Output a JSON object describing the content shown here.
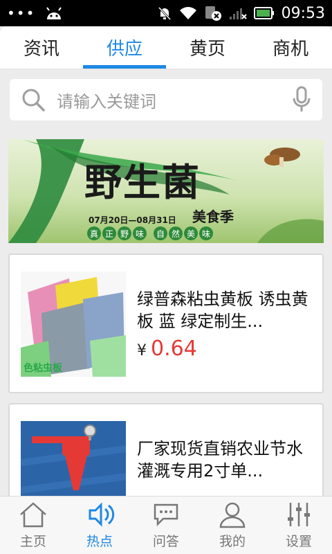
{
  "status_bar": {
    "dots": "•••",
    "time": "09:53"
  },
  "tabs": [
    {
      "label": "资讯",
      "active": false
    },
    {
      "label": "供应",
      "active": true
    },
    {
      "label": "黄页",
      "active": false
    },
    {
      "label": "商机",
      "active": false
    }
  ],
  "search": {
    "placeholder": "请输入关键词"
  },
  "banner": {
    "title": "野生菌",
    "subtitle": "美食季",
    "date": "07月20日—08月31日",
    "tags_left": [
      "真",
      "正",
      "野",
      "味"
    ],
    "tags_right": [
      "自",
      "然",
      "美",
      "味"
    ]
  },
  "products": [
    {
      "title": "绿普森粘虫黄板 诱虫黄板 蓝 绿定制生...",
      "currency": "¥",
      "price": "0.64",
      "thumb_caption": "色粘虫板"
    },
    {
      "title": "厂家现货直销农业节水灌溉专用2寸单...",
      "currency": "",
      "price": ""
    }
  ],
  "bottom_nav": [
    {
      "label": "主页",
      "icon": "home-icon",
      "active": false
    },
    {
      "label": "热点",
      "icon": "speaker-icon",
      "active": true
    },
    {
      "label": "问答",
      "icon": "chat-icon",
      "active": false
    },
    {
      "label": "我的",
      "icon": "user-icon",
      "active": false
    },
    {
      "label": "设置",
      "icon": "sliders-icon",
      "active": false
    }
  ],
  "colors": {
    "accent": "#1e88e5",
    "price": "#e53935"
  }
}
